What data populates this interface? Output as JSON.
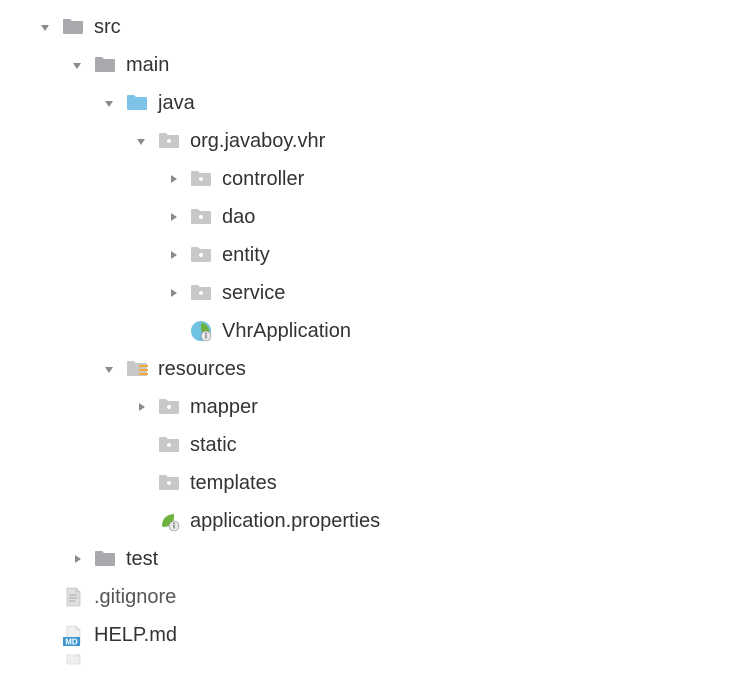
{
  "colors": {
    "folder_gray": "#a7a9ac",
    "folder_blue": "#7cc3e7",
    "arrow": "#8a8a8a",
    "text": "#333333",
    "resources_badge": "#f2a93c",
    "spring_green": "#6db33f",
    "md_blue": "#3b97d3",
    "file_gray": "#b0b0b0"
  },
  "tree": {
    "src": "src",
    "main": "main",
    "java": "java",
    "pkg": "org.javaboy.vhr",
    "controller": "controller",
    "dao": "dao",
    "entity": "entity",
    "service": "service",
    "vhrapp": "VhrApplication",
    "resources": "resources",
    "mapper": "mapper",
    "static": "static",
    "templates": "templates",
    "appprops": "application.properties",
    "test": "test",
    "gitignore": ".gitignore",
    "helpmd": "HELP.md"
  }
}
